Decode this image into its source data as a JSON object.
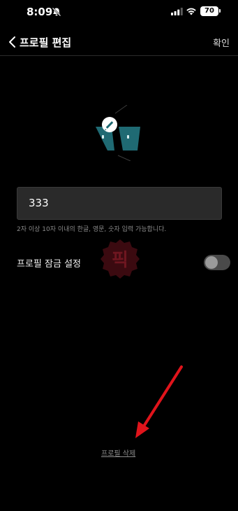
{
  "status_bar": {
    "time": "8:09",
    "battery": "70",
    "icons": [
      "bell-slash-icon",
      "signal-icon",
      "wifi-icon",
      "battery-icon"
    ]
  },
  "nav": {
    "title": "프로필 편집",
    "confirm_label": "확인"
  },
  "nickname": {
    "value": "333",
    "hint": "2자 이상 10자 이내의 한글, 영문, 숫자 입력 가능합니다."
  },
  "lock": {
    "label": "프로필 잠금 설정",
    "enabled": false
  },
  "watermark_text": "픽",
  "delete_label": "프로필 삭제",
  "colors": {
    "background": "#000000",
    "input_background": "#2a2a2a",
    "avatar_teal": "#1f6a73",
    "arrow": "#e0141b"
  }
}
